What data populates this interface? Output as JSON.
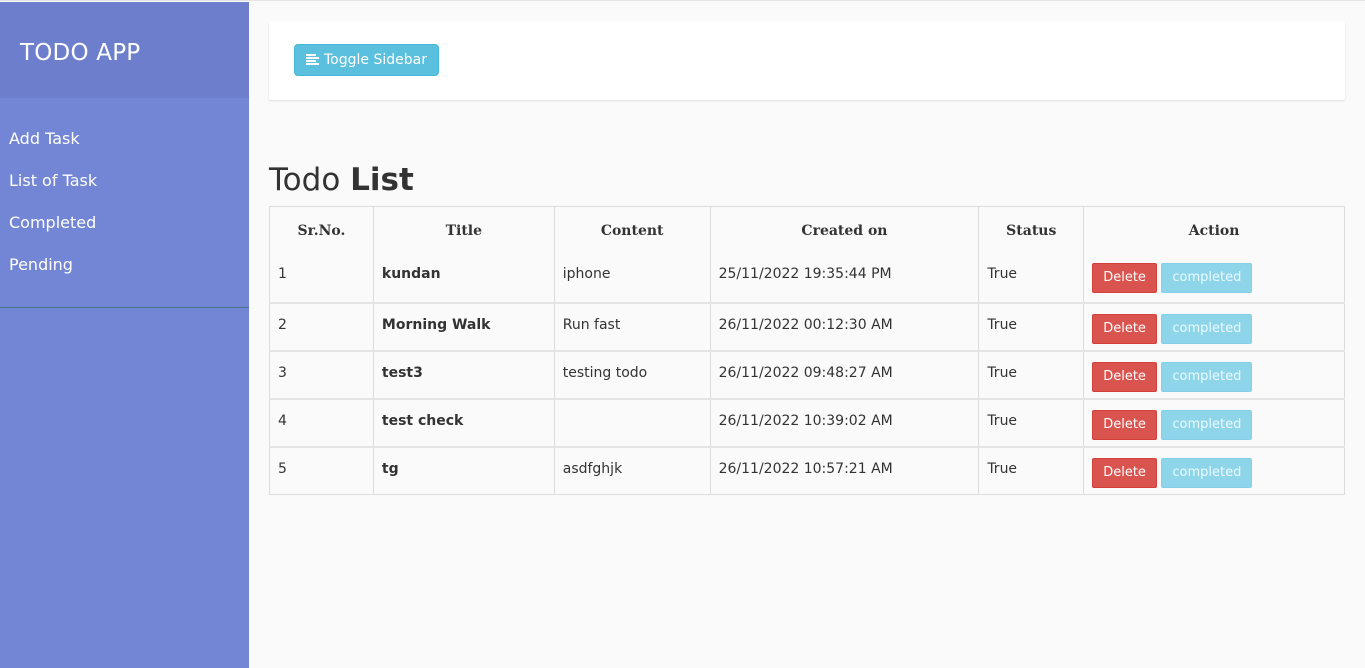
{
  "sidebar": {
    "title": "TODO APP",
    "items": [
      {
        "label": "Add Task"
      },
      {
        "label": "List of Task"
      },
      {
        "label": "Completed"
      },
      {
        "label": "Pending"
      }
    ]
  },
  "navbar": {
    "toggle_label": "Toggle Sidebar",
    "toggle_icon": "align-left-icon"
  },
  "page": {
    "title_light": "Todo ",
    "title_bold": "List"
  },
  "table": {
    "headers": [
      "Sr.No.",
      "Title",
      "Content",
      "Created on",
      "Status",
      "Action"
    ],
    "rows": [
      {
        "sr": "1",
        "title": "kundan",
        "content": "iphone",
        "created": "25/11/2022 19:35:44 PM",
        "status": "True"
      },
      {
        "sr": "2",
        "title": "Morning Walk",
        "content": "Run fast",
        "created": "26/11/2022 00:12:30 AM",
        "status": "True"
      },
      {
        "sr": "3",
        "title": "test3",
        "content": "testing todo",
        "created": "26/11/2022 09:48:27 AM",
        "status": "True"
      },
      {
        "sr": "4",
        "title": "test check",
        "content": "",
        "created": "26/11/2022 10:39:02 AM",
        "status": "True"
      },
      {
        "sr": "5",
        "title": "tg",
        "content": "asdfghjk",
        "created": "26/11/2022 10:57:21 AM",
        "status": "True"
      }
    ],
    "delete_label": "Delete",
    "completed_label": "completed"
  },
  "colors": {
    "sidebar_bg": "#7386d5",
    "sidebar_header_bg": "#6d7fcc",
    "info": "#5bc0de",
    "danger": "#d9534f"
  }
}
